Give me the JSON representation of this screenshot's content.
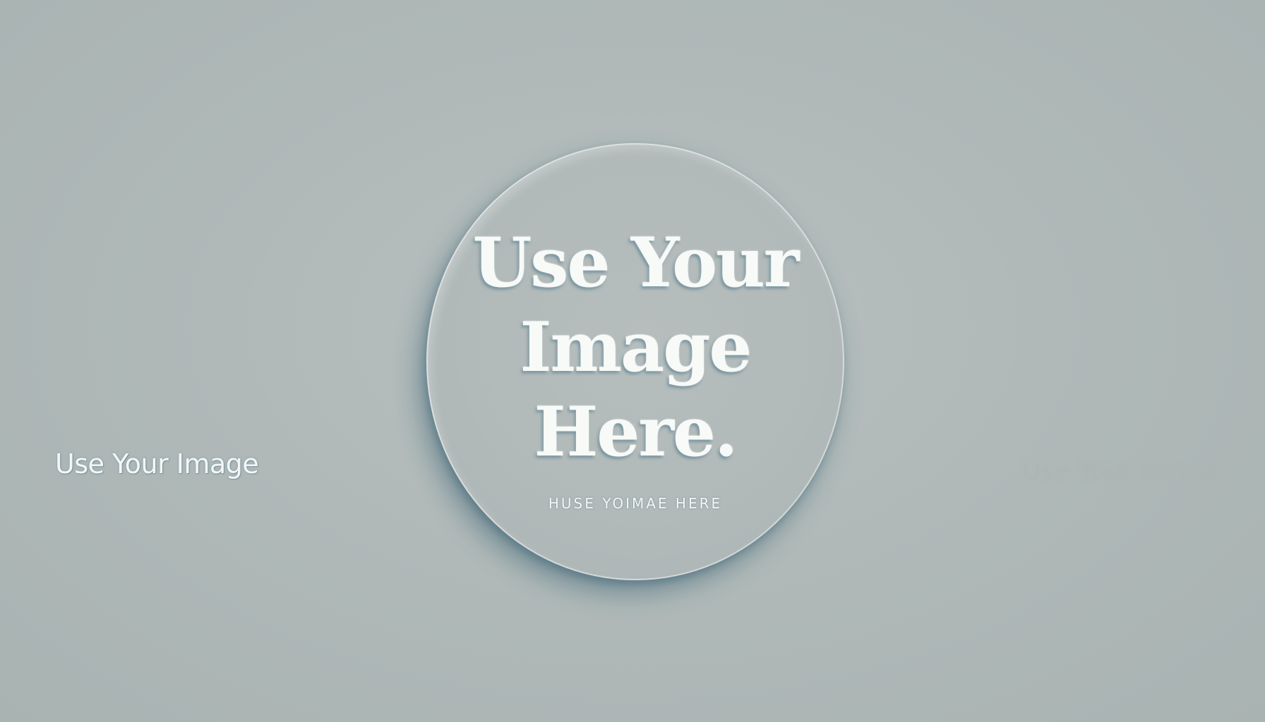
{
  "left_caption": "Use Your Image",
  "right_caption": "Use Your Image",
  "disc": {
    "title_lines": [
      "Use Your",
      "Image",
      "Here."
    ],
    "subtitle": "HUSE YOIMAE HERE"
  },
  "colors": {
    "background": "#b0b9b8",
    "disc": "#b3baba",
    "text": "#f8faf8",
    "shadow": "#325f73"
  }
}
